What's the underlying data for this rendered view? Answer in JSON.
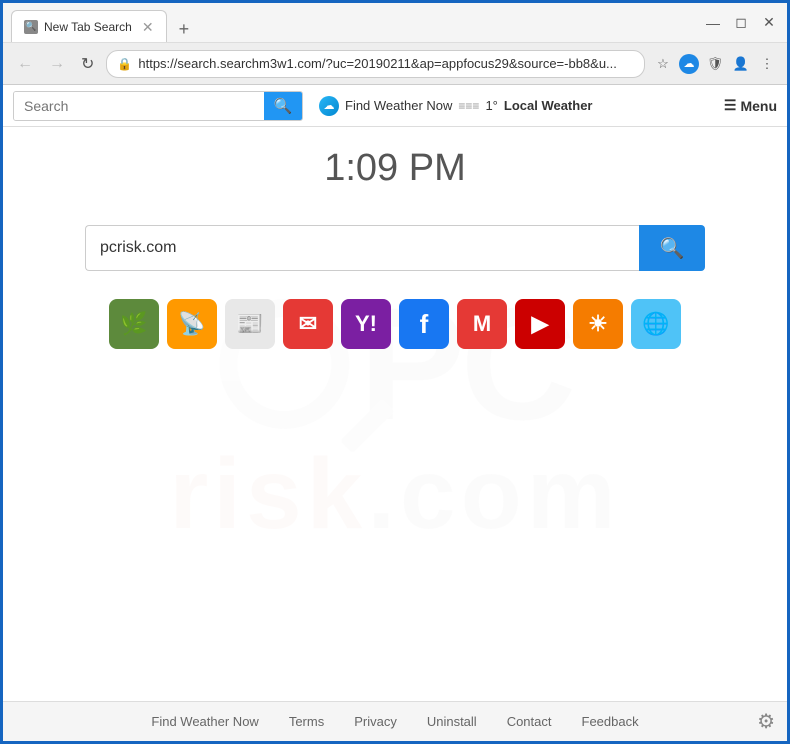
{
  "browser": {
    "tab_title": "New Tab Search",
    "tab_favicon": "🔍",
    "address_url": "https://search.searchm3w1.com/?uc=20190211&ap=appfocus29&source=-bb8&u...",
    "new_tab_btn": "+",
    "window_minimize": "—",
    "window_maximize": "◻",
    "window_close": "✕"
  },
  "nav": {
    "back": "←",
    "forward": "→",
    "refresh": "↻"
  },
  "toolbar": {
    "search_placeholder": "Search",
    "search_icon": "🔍",
    "weather_icon": "☁",
    "weather_label": "Find Weather Now",
    "weather_separator": "≡≡≡",
    "temperature": "1°",
    "local_weather": "Local Weather",
    "menu_icon": "☰",
    "menu_label": "Menu"
  },
  "page": {
    "time": "1:09 PM",
    "search_value": "pcrisk.com",
    "search_placeholder": "pcrisk.com"
  },
  "shortcuts": [
    {
      "id": "herb",
      "bg": "#5D8A3C",
      "label": "🌿"
    },
    {
      "id": "audible",
      "bg": "#FF9900",
      "label": "📡"
    },
    {
      "id": "news",
      "bg": "#E0E0E0",
      "label": "📰",
      "dark": true
    },
    {
      "id": "gmail-red",
      "bg": "#E53935",
      "label": "✉"
    },
    {
      "id": "yahoo",
      "bg": "#7B1FA2",
      "label": "Y"
    },
    {
      "id": "facebook",
      "bg": "#1877F2",
      "label": "f"
    },
    {
      "id": "gmail-m",
      "bg": "#E53935",
      "label": "M"
    },
    {
      "id": "youtube",
      "bg": "#CC0000",
      "label": "▶"
    },
    {
      "id": "weather-orange",
      "bg": "#F57C00",
      "label": "☀"
    },
    {
      "id": "globe",
      "bg": "#4FC3F7",
      "label": "🌐"
    }
  ],
  "footer": {
    "links": [
      {
        "id": "find-weather",
        "label": "Find Weather Now"
      },
      {
        "id": "terms",
        "label": "Terms"
      },
      {
        "id": "privacy",
        "label": "Privacy"
      },
      {
        "id": "uninstall",
        "label": "Uninstall"
      },
      {
        "id": "contact",
        "label": "Contact"
      },
      {
        "id": "feedback",
        "label": "Feedback"
      }
    ],
    "gear_icon": "⚙"
  }
}
